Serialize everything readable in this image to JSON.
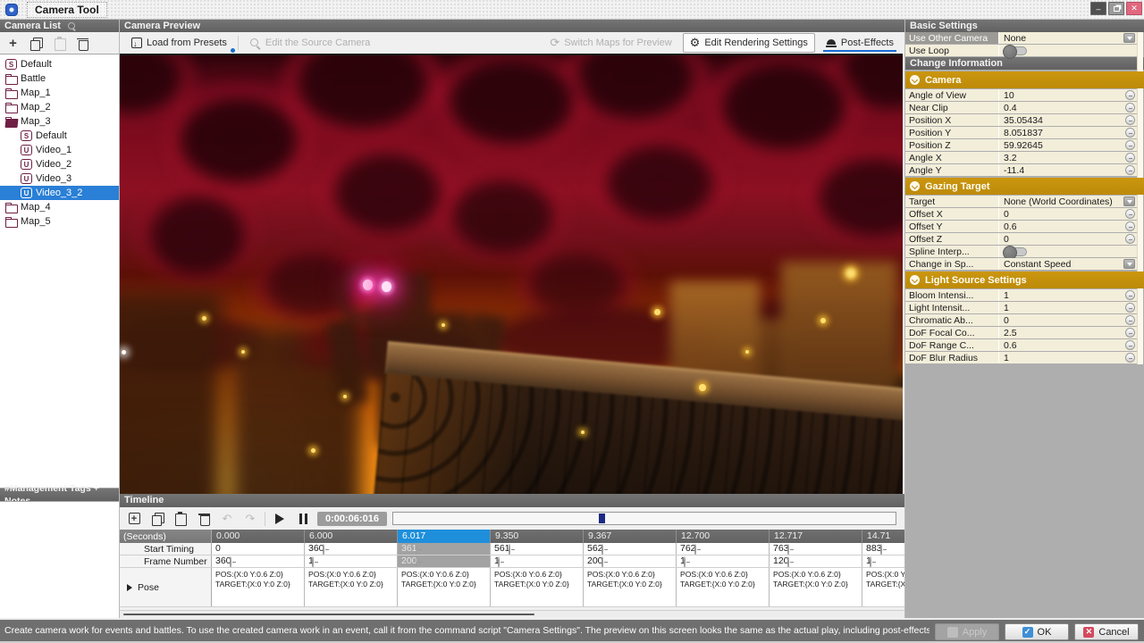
{
  "window": {
    "title": "Camera Tool"
  },
  "camera_list": {
    "header": "Camera List",
    "tags_header": "#Management Tags + Notes",
    "tree": [
      {
        "label": "Default",
        "icon": "scene",
        "depth": 0,
        "selected": false
      },
      {
        "label": "Battle",
        "icon": "folder",
        "depth": 0,
        "selected": false
      },
      {
        "label": "Map_1",
        "icon": "folder",
        "depth": 0,
        "selected": false
      },
      {
        "label": "Map_2",
        "icon": "folder",
        "depth": 0,
        "selected": false
      },
      {
        "label": "Map_3",
        "icon": "folder-open",
        "depth": 0,
        "selected": false
      },
      {
        "label": "Default",
        "icon": "scene",
        "depth": 1,
        "selected": false
      },
      {
        "label": "Video_1",
        "icon": "video",
        "depth": 1,
        "selected": false
      },
      {
        "label": "Video_2",
        "icon": "video",
        "depth": 1,
        "selected": false
      },
      {
        "label": "Video_3",
        "icon": "video",
        "depth": 1,
        "selected": false
      },
      {
        "label": "Video_3_2",
        "icon": "video",
        "depth": 1,
        "selected": true
      },
      {
        "label": "Map_4",
        "icon": "folder",
        "depth": 0,
        "selected": false
      },
      {
        "label": "Map_5",
        "icon": "folder",
        "depth": 0,
        "selected": false
      }
    ]
  },
  "preview": {
    "header": "Camera Preview",
    "toolbar": {
      "load_from_presets": "Load from Presets",
      "edit_source_camera": "Edit the Source Camera",
      "switch_maps": "Switch Maps for Preview",
      "edit_rendering": "Edit Rendering Settings",
      "post_effects": "Post-Effects"
    }
  },
  "timeline": {
    "header": "Timeline",
    "time_display": "0:00:06:016",
    "row_labels": {
      "seconds": "(Seconds)",
      "start_timing": "Start Timing",
      "frame_number": "Frame Number",
      "pose": "Pose"
    },
    "pose_value": "POS:{X:0 Y:0.6 Z:0} TARGET:{X:0 Y:0 Z:0}",
    "columns": [
      {
        "time": "0.000",
        "start": "0",
        "frame": "360",
        "selected": false,
        "start_minus": false
      },
      {
        "time": "6.000",
        "start": "360",
        "frame": "1",
        "selected": false,
        "start_minus": true
      },
      {
        "time": "6.017",
        "start": "361",
        "frame": "200",
        "selected": true,
        "start_minus": true
      },
      {
        "time": "9.350",
        "start": "561",
        "frame": "1",
        "selected": false,
        "start_minus": true
      },
      {
        "time": "9.367",
        "start": "562",
        "frame": "200",
        "selected": false,
        "start_minus": true
      },
      {
        "time": "12.700",
        "start": "762",
        "frame": "1",
        "selected": false,
        "start_minus": true
      },
      {
        "time": "12.717",
        "start": "763",
        "frame": "120",
        "selected": false,
        "start_minus": true
      },
      {
        "time": "14.71",
        "start": "883",
        "frame": "1",
        "selected": false,
        "start_minus": true
      }
    ]
  },
  "settings": {
    "basic_header": "Basic Settings",
    "change_header": "Change Information",
    "basic_rows": [
      {
        "label": "Use Other Camera",
        "value": "None",
        "control": "dropdown",
        "label_highlight": true
      },
      {
        "label": "Use Loop",
        "control": "toggle",
        "label_highlight": false
      }
    ],
    "sections": [
      {
        "title": "Camera",
        "rows": [
          {
            "label": "Angle of View",
            "value": "10",
            "control": "minus"
          },
          {
            "label": "Near Clip",
            "value": "0.4",
            "control": "minus"
          },
          {
            "label": "Position X",
            "value": "35.05434",
            "control": "minus"
          },
          {
            "label": "Position Y",
            "value": "8.051837",
            "control": "minus"
          },
          {
            "label": "Position Z",
            "value": "59.92645",
            "control": "minus"
          },
          {
            "label": "Angle X",
            "value": "3.2",
            "control": "minus"
          },
          {
            "label": "Angle Y",
            "value": "-11.4",
            "control": "minus"
          }
        ]
      },
      {
        "title": "Gazing Target",
        "rows": [
          {
            "label": "Target",
            "value": "None (World Coordinates)",
            "control": "dropdown"
          },
          {
            "label": "Offset X",
            "value": "0",
            "control": "minus"
          },
          {
            "label": "Offset Y",
            "value": "0.6",
            "control": "minus"
          },
          {
            "label": "Offset Z",
            "value": "0",
            "control": "minus"
          },
          {
            "label": "Spline Interp...",
            "control": "toggle"
          },
          {
            "label": "Change in Sp...",
            "value": "Constant Speed",
            "control": "dropdown"
          }
        ]
      },
      {
        "title": "Light Source Settings",
        "rows": [
          {
            "label": "Bloom Intensi...",
            "value": "1",
            "control": "minus"
          },
          {
            "label": "Light Intensit...",
            "value": "1",
            "control": "minus"
          },
          {
            "label": "Chromatic Ab...",
            "value": "0",
            "control": "minus"
          },
          {
            "label": "DoF Focal Co...",
            "value": "2.5",
            "control": "minus"
          },
          {
            "label": "DoF Range C...",
            "value": "0.6",
            "control": "minus"
          },
          {
            "label": "DoF Blur Radius",
            "value": "1",
            "control": "minus"
          }
        ]
      }
    ]
  },
  "status_bar": {
    "text": "Create camera work for events and battles. To use the created camera work in an event, call it from the command script \"Camera Settings\". The preview on this screen looks the same as the actual play, including post-effects.",
    "apply": "Apply",
    "ok": "OK",
    "cancel": "Cancel"
  }
}
